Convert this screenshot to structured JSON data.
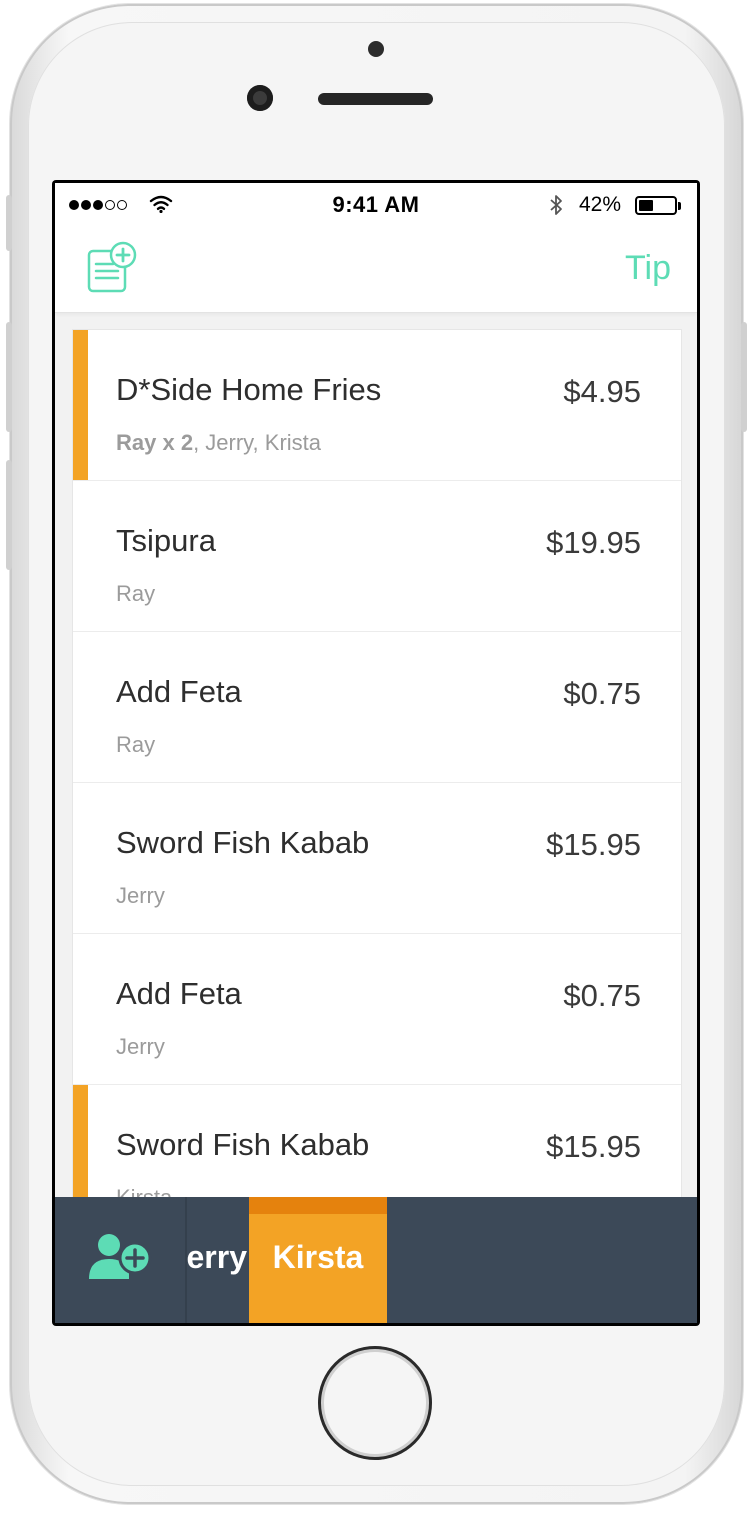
{
  "status_bar": {
    "time": "9:41 AM",
    "battery": "42%",
    "battery_level": 0.42
  },
  "nav": {
    "tip_label": "Tip",
    "add_receipt_icon": "receipt-add-icon"
  },
  "colors": {
    "accent_green": "#5ddcb5",
    "selected_orange": "#f3a325",
    "tabbar_bg": "#3c4958"
  },
  "items": [
    {
      "name": "D*Side Home Fries",
      "price": "$4.95",
      "people_bold": "Ray x 2",
      "people_rest": ", Jerry, Krista",
      "selected": true
    },
    {
      "name": "Tsipura",
      "price": "$19.95",
      "people_bold": "",
      "people_rest": "Ray",
      "selected": false
    },
    {
      "name": "Add Feta",
      "price": "$0.75",
      "people_bold": "",
      "people_rest": "Ray",
      "selected": false
    },
    {
      "name": "Sword Fish Kabab",
      "price": "$15.95",
      "people_bold": "",
      "people_rest": "Jerry",
      "selected": false
    },
    {
      "name": "Add Feta",
      "price": "$0.75",
      "people_bold": "",
      "people_rest": "Jerry",
      "selected": false
    },
    {
      "name": "Sword Fish Kabab",
      "price": "$15.95",
      "people_bold": "",
      "people_rest": "Kirsta",
      "selected": true
    }
  ],
  "tabbar": {
    "add_person_icon": "add-person-icon",
    "partial_tab_label": "Jerry",
    "active_tab_label": "Kirsta"
  }
}
